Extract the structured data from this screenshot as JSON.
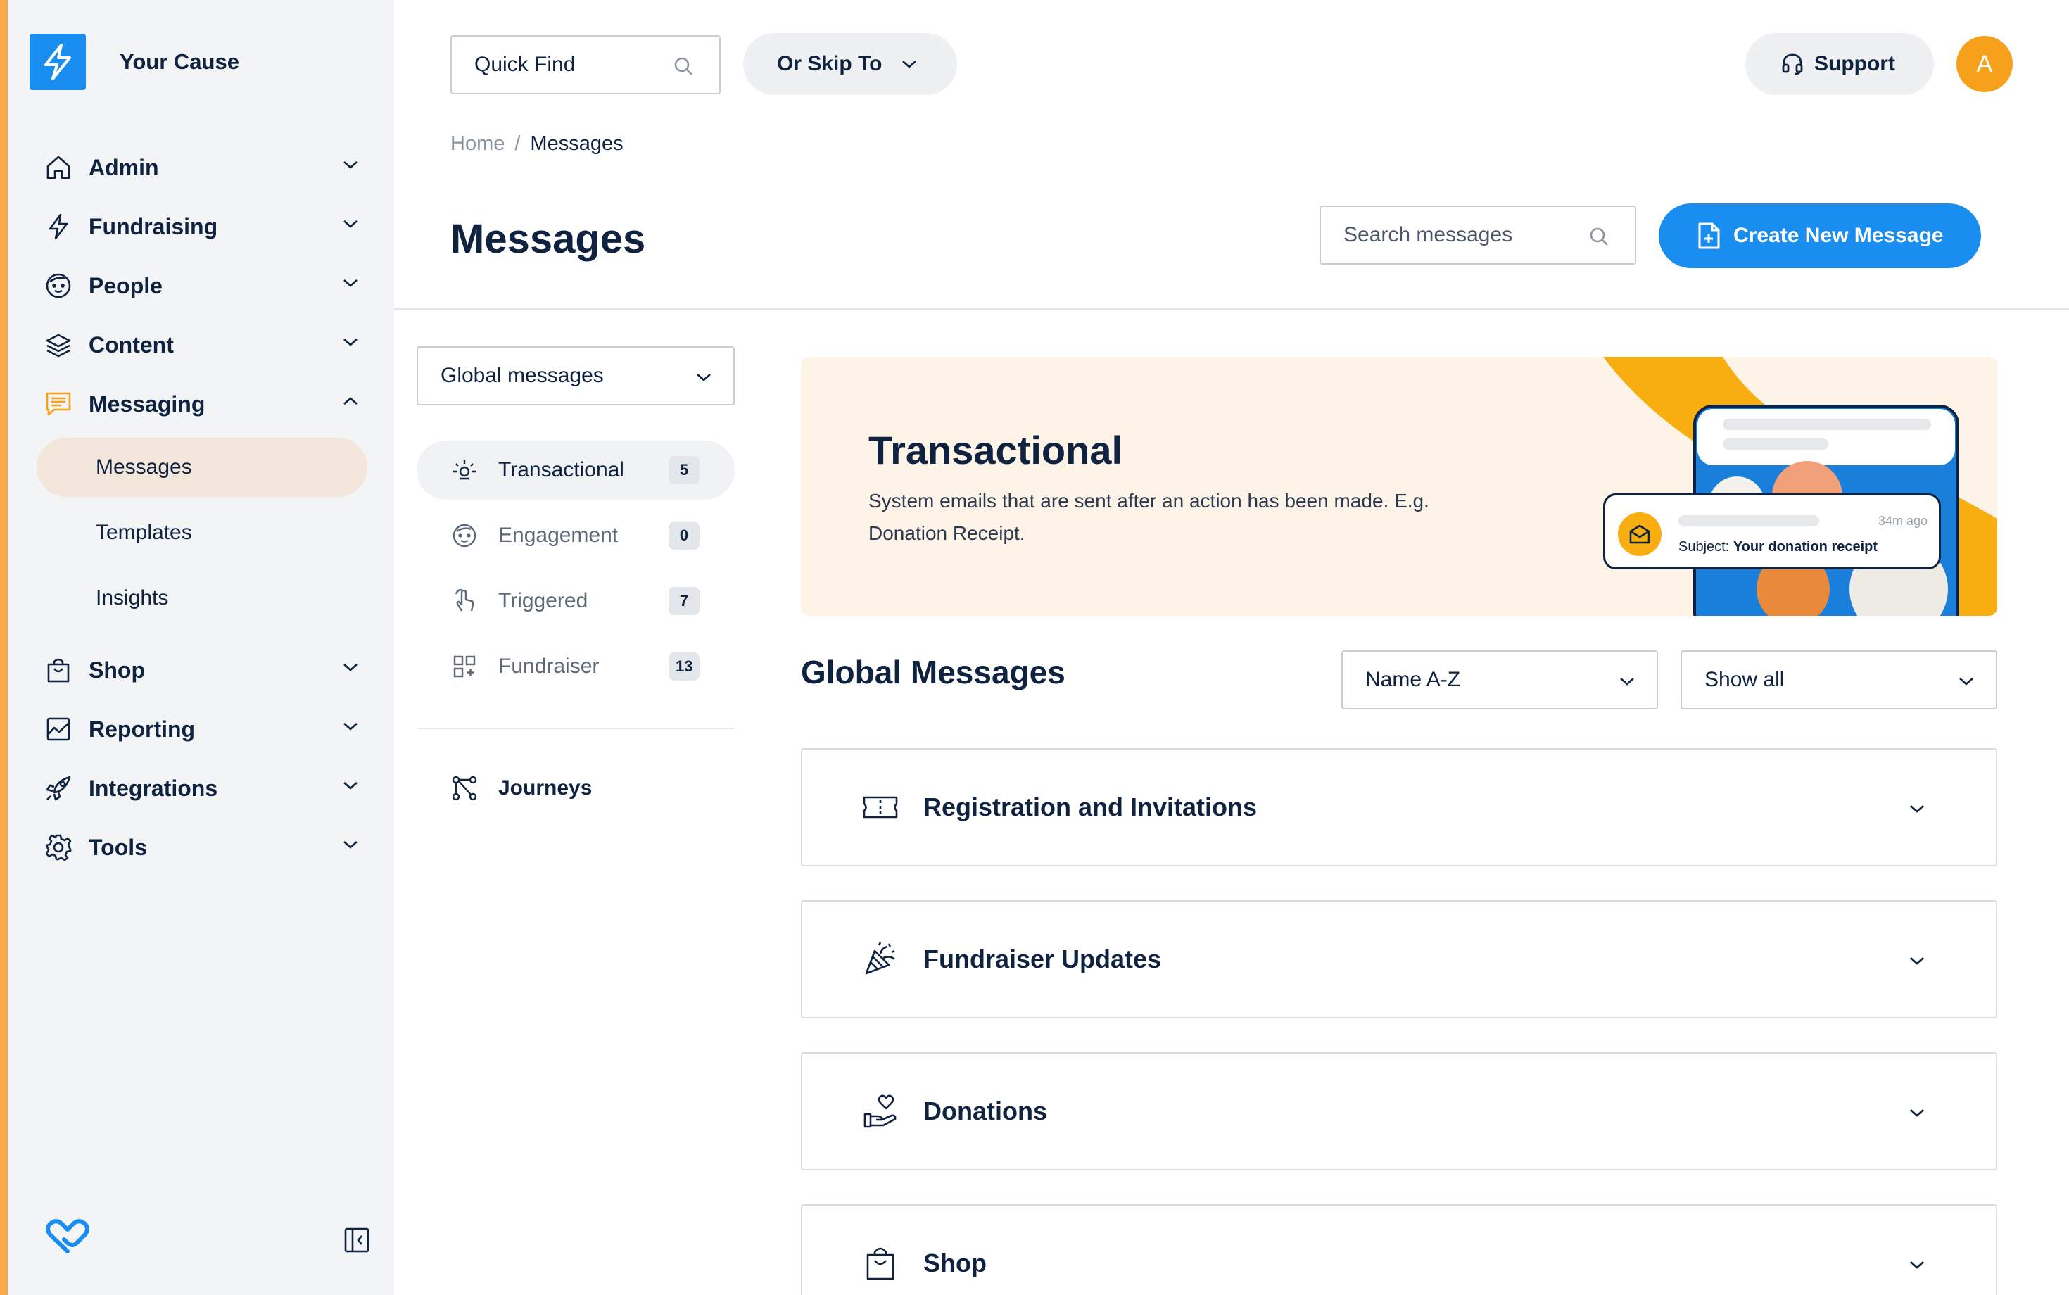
{
  "brand": {
    "name": "Your Cause"
  },
  "colors": {
    "accent": "#1a8ef0",
    "sidebar_stripe": "#f7a84a",
    "avatar": "#f7a01c",
    "active_item_bg": "#f3e6da",
    "hero_bg": "#fdf4e7"
  },
  "sidebar": {
    "items": [
      {
        "label": "Admin",
        "icon": "home-icon"
      },
      {
        "label": "Fundraising",
        "icon": "lightning-icon"
      },
      {
        "label": "People",
        "icon": "face-icon"
      },
      {
        "label": "Content",
        "icon": "layers-icon"
      },
      {
        "label": "Messaging",
        "icon": "chat-icon"
      }
    ],
    "messaging_sub": [
      "Messages",
      "Templates",
      "Insights"
    ],
    "items_after": [
      {
        "label": "Shop",
        "icon": "shopping-bag-icon"
      },
      {
        "label": "Reporting",
        "icon": "chart-icon"
      },
      {
        "label": "Integrations",
        "icon": "rocket-icon"
      },
      {
        "label": "Tools",
        "icon": "gear-icon"
      }
    ]
  },
  "topbar": {
    "quick_find": "Quick Find",
    "skip_to": "Or Skip To",
    "support": "Support",
    "avatar_initial": "A"
  },
  "breadcrumb": {
    "home": "Home",
    "separator": "/",
    "current": "Messages"
  },
  "page": {
    "title": "Messages",
    "search_placeholder": "Search messages",
    "create_button": "Create New Message"
  },
  "panel": {
    "scope": "Global messages",
    "categories": [
      {
        "label": "Transactional",
        "count": "5",
        "icon": "sparkle-icon"
      },
      {
        "label": "Engagement",
        "count": "0",
        "icon": "face-icon"
      },
      {
        "label": "Triggered",
        "count": "7",
        "icon": "pointer-icon"
      },
      {
        "label": "Fundraiser",
        "count": "13",
        "icon": "grid-icon"
      }
    ],
    "journeys": "Journeys"
  },
  "hero": {
    "title": "Transactional",
    "description": "System emails that are sent after an action has been made. E.g. Donation Receipt.",
    "notification_time": "34m ago",
    "notification_subject_label": "Subject:",
    "notification_subject": "Your donation receipt"
  },
  "global_messages": {
    "title": "Global Messages",
    "sort": "Name A-Z",
    "filter": "Show all",
    "sections": [
      {
        "label": "Registration and Invitations",
        "icon": "ticket-icon"
      },
      {
        "label": "Fundraiser Updates",
        "icon": "party-popper-icon"
      },
      {
        "label": "Donations",
        "icon": "heart-hand-icon"
      },
      {
        "label": "Shop",
        "icon": "shopping-bag-icon"
      }
    ]
  }
}
